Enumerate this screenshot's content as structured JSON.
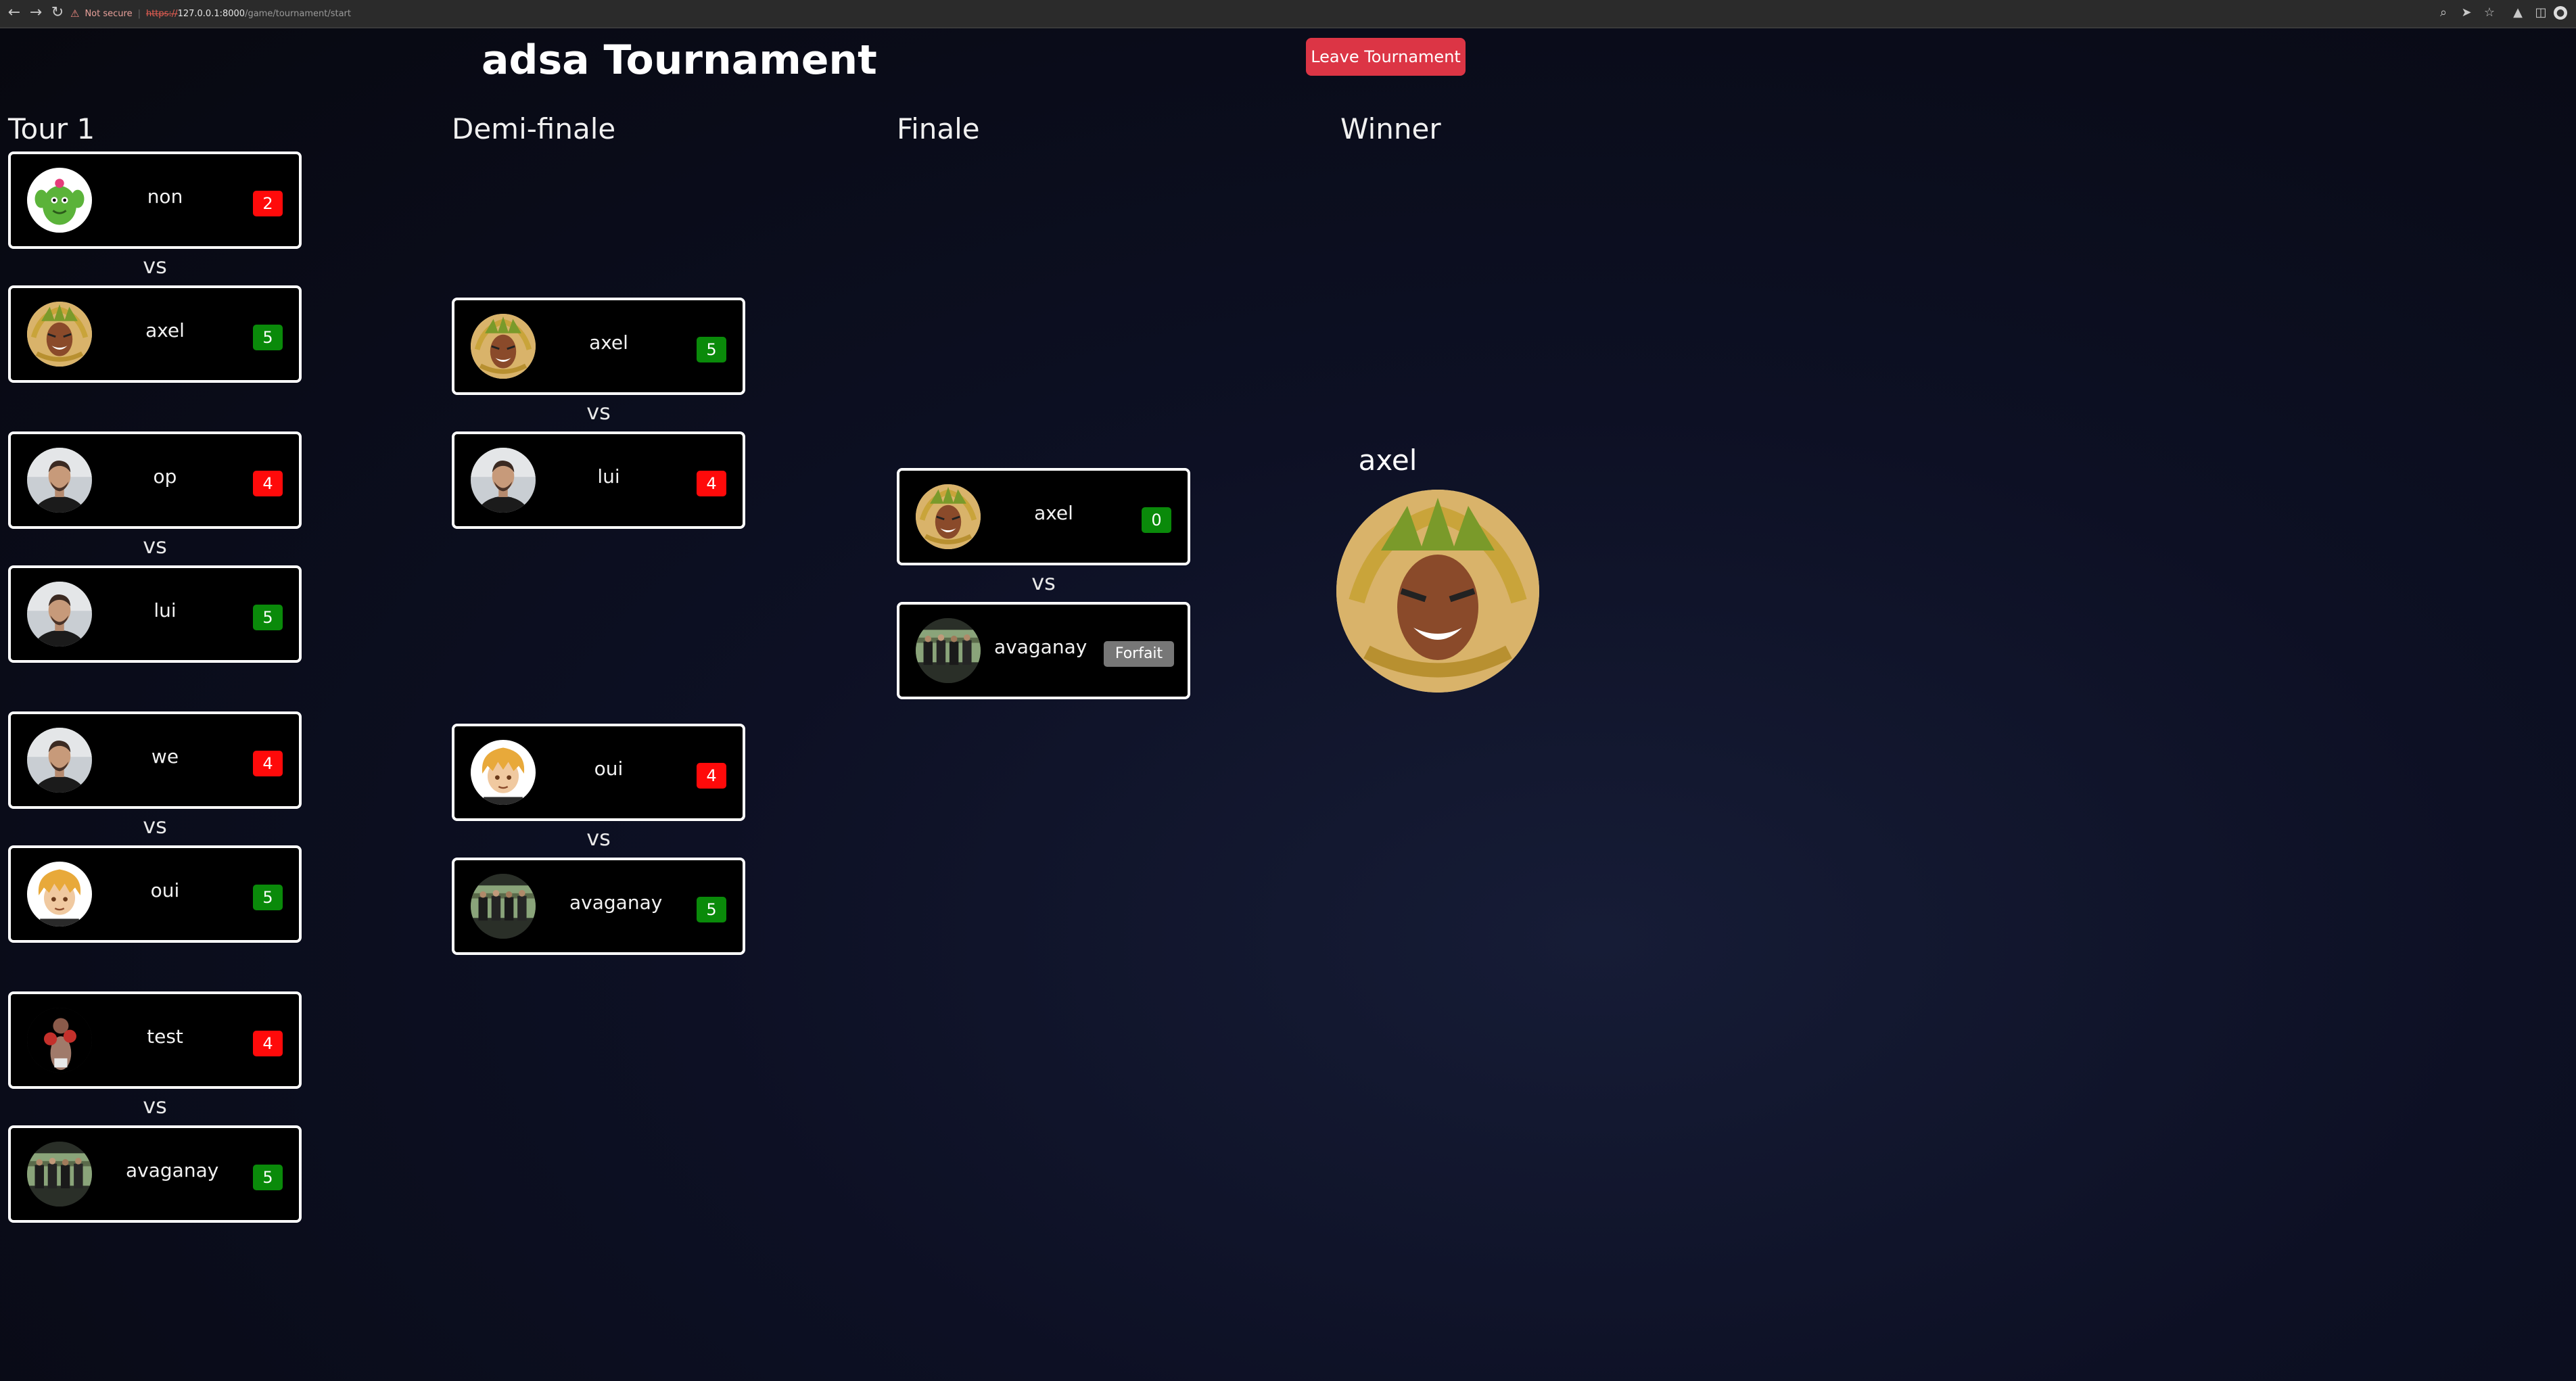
{
  "browser": {
    "security_label": "Not secure",
    "separator": "|",
    "url_scheme": "https://",
    "url_host": "127.0.0.1:8000",
    "url_path": "/game/tournament/start"
  },
  "header": {
    "title": "adsa Tournament",
    "leave_label": "Leave Tournament"
  },
  "rounds": {
    "r1": "Tour 1",
    "semi": "Demi-finale",
    "final": "Finale",
    "winner": "Winner"
  },
  "vs_label": "vs",
  "tour1": [
    {
      "p1": {
        "name": "non",
        "score": "2",
        "avatar": "cactus-character"
      },
      "p2": {
        "name": "axel",
        "score": "5",
        "avatar": "laurel-warrior"
      }
    },
    {
      "p1": {
        "name": "op",
        "score": "4",
        "avatar": "man-photo"
      },
      "p2": {
        "name": "lui",
        "score": "5",
        "avatar": "man-photo"
      }
    },
    {
      "p1": {
        "name": "we",
        "score": "4",
        "avatar": "man-photo"
      },
      "p2": {
        "name": "oui",
        "score": "5",
        "avatar": "blonde-character"
      }
    },
    {
      "p1": {
        "name": "test",
        "score": "4",
        "avatar": "boxer"
      },
      "p2": {
        "name": "avaganay",
        "score": "5",
        "avatar": "group-photo"
      }
    }
  ],
  "semi": [
    {
      "p1": {
        "name": "axel",
        "score": "5",
        "avatar": "laurel-warrior"
      },
      "p2": {
        "name": "lui",
        "score": "4",
        "avatar": "man-photo"
      }
    },
    {
      "p1": {
        "name": "oui",
        "score": "4",
        "avatar": "blonde-character"
      },
      "p2": {
        "name": "avaganay",
        "score": "5",
        "avatar": "group-photo"
      }
    }
  ],
  "final": {
    "p1": {
      "name": "axel",
      "score": "0",
      "avatar": "laurel-warrior"
    },
    "p2": {
      "name": "avaganay",
      "status": "Forfait",
      "avatar": "group-photo"
    }
  },
  "winner": {
    "name": "axel",
    "avatar": "laurel-warrior"
  },
  "colors": {
    "lose": "#ff0a0a",
    "win": "#0a8a0a",
    "forfeit": "#777777",
    "leave_button": "#dc3545"
  }
}
